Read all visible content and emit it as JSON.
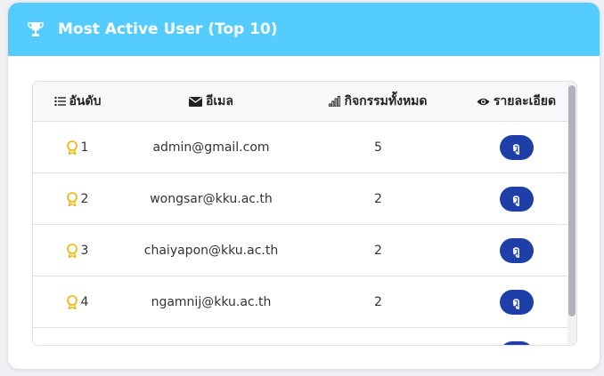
{
  "header": {
    "title": "Most Active User (Top 10)",
    "icon": "trophy-icon"
  },
  "colors": {
    "header_bg": "#55ccff",
    "button_bg": "#1e3fa8",
    "medal": "#f0b400"
  },
  "table": {
    "columns": [
      {
        "label": "อันดับ",
        "icon": "list-icon"
      },
      {
        "label": "อีเมล",
        "icon": "envelope-icon"
      },
      {
        "label": "กิจกรรมทั้งหมด",
        "icon": "bar-chart-icon"
      },
      {
        "label": "รายละเอียด",
        "icon": "eye-icon"
      }
    ],
    "rows": [
      {
        "rank": "1",
        "email": "admin@gmail.com",
        "count": "5",
        "action": "ดู"
      },
      {
        "rank": "2",
        "email": "wongsar@kku.ac.th",
        "count": "2",
        "action": "ดู"
      },
      {
        "rank": "3",
        "email": "chaiyapon@kku.ac.th",
        "count": "2",
        "action": "ดู"
      },
      {
        "rank": "4",
        "email": "ngamnij@kku.ac.th",
        "count": "2",
        "action": "ดู"
      },
      {
        "rank": "",
        "email": "",
        "count": "",
        "action": ""
      }
    ]
  }
}
